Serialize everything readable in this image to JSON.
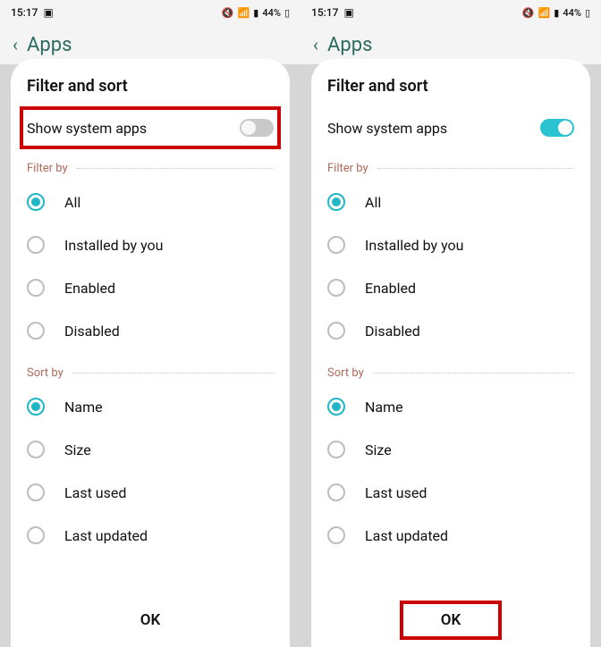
{
  "status": {
    "time": "15:17",
    "battery": "44%"
  },
  "page_title": "Apps",
  "sheet": {
    "title": "Filter and sort",
    "toggle_label": "Show system apps",
    "filter_label": "Filter by",
    "sort_label": "Sort by",
    "filter_options": [
      {
        "label": "All",
        "selected": true
      },
      {
        "label": "Installed by you",
        "selected": false
      },
      {
        "label": "Enabled",
        "selected": false
      },
      {
        "label": "Disabled",
        "selected": false
      }
    ],
    "sort_options": [
      {
        "label": "Name",
        "selected": true
      },
      {
        "label": "Size",
        "selected": false
      },
      {
        "label": "Last used",
        "selected": false
      },
      {
        "label": "Last updated",
        "selected": false
      }
    ],
    "ok": "OK"
  },
  "left": {
    "toggle_on": false,
    "highlight_toggle": true,
    "highlight_ok": false
  },
  "right": {
    "toggle_on": true,
    "highlight_toggle": false,
    "highlight_ok": true
  }
}
